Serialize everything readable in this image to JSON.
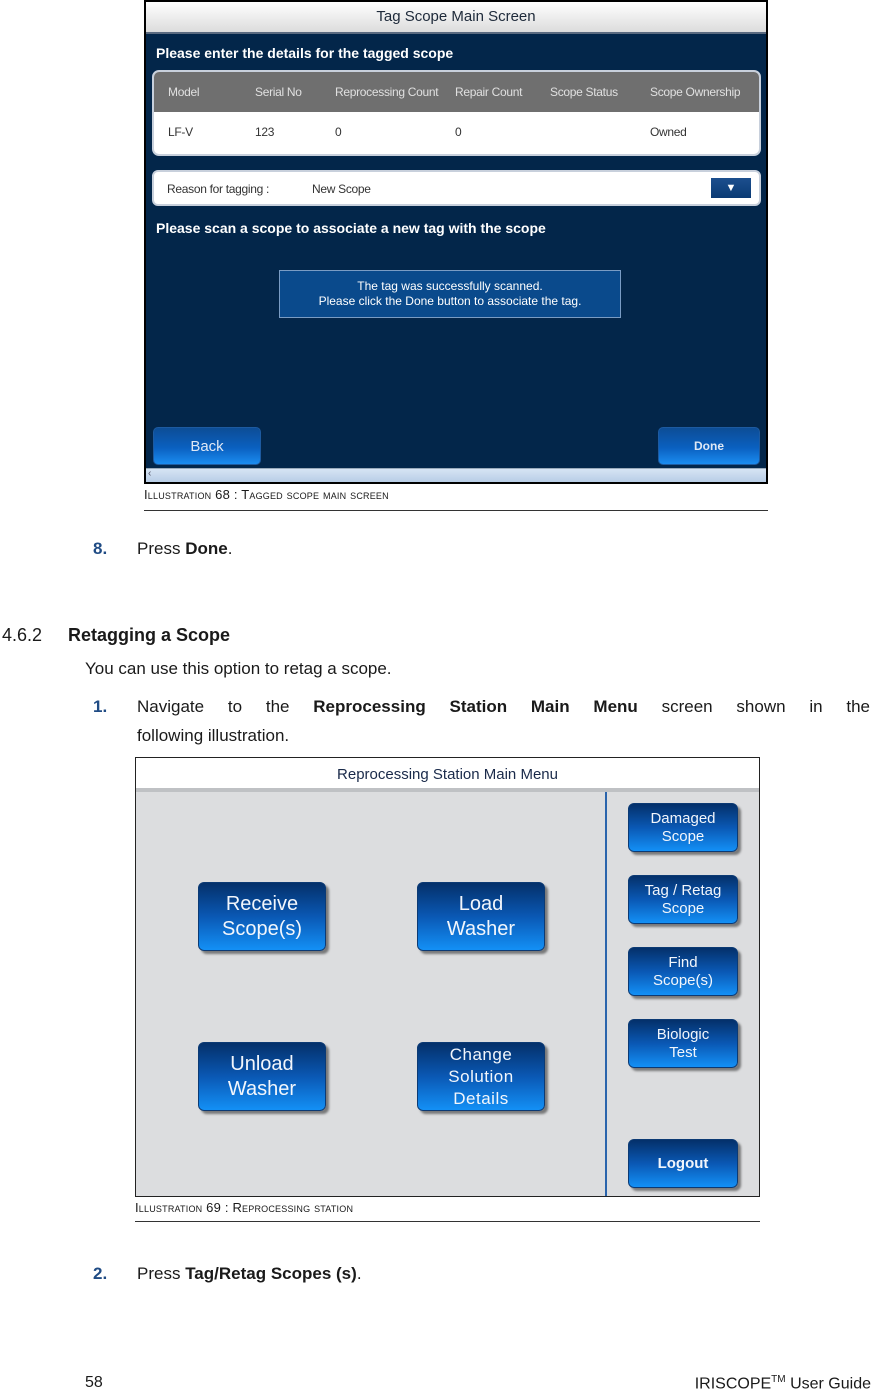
{
  "screen1": {
    "title": "Tag Scope Main Screen",
    "prompt": "Please enter the details for the tagged scope",
    "table": {
      "columns": [
        "Model",
        "Serial No",
        "Reprocessing Count",
        "Repair Count",
        "Scope Status",
        "Scope Ownership"
      ],
      "rows": [
        [
          "LF-V",
          "123",
          "0",
          "0",
          "",
          "Owned"
        ]
      ]
    },
    "reason": {
      "label": "Reason for tagging :",
      "value": "New Scope",
      "icon": "dropdown-arrow-icon"
    },
    "scan_prompt": "Please scan a scope to associate a new tag with the scope",
    "message_line1": "The tag was successfully scanned.",
    "message_line2": "Please click the Done button to associate the tag.",
    "back_label": "Back",
    "done_label": "Done",
    "scroll_icon": "‹"
  },
  "caption1": "Illustration 68 : Tagged scope main screen",
  "step8": {
    "num": "8.",
    "pre": "Press ",
    "bold": "Done",
    "post": "."
  },
  "section": {
    "num": "4.6.2",
    "title": "Retagging a Scope"
  },
  "intro": "You can use this option to retag a scope.",
  "step1": {
    "num": "1.",
    "pre": "Navigate to the ",
    "bold": "Reprocessing Station Main Menu",
    "post": " screen shown in the",
    "line2": "following illustration."
  },
  "screen2": {
    "title": "Reprocessing Station Main Menu",
    "buttons": {
      "receive_l1": "Receive",
      "receive_l2": "Scope(s)",
      "load_l1": "Load",
      "load_l2": "Washer",
      "unload_l1": "Unload",
      "unload_l2": "Washer",
      "change_l1": "Change",
      "change_l2": "Solution Details",
      "damaged_l1": "Damaged",
      "damaged_l2": "Scope",
      "tag_l1": "Tag / Retag",
      "tag_l2": "Scope",
      "find_l1": "Find",
      "find_l2": "Scope(s)",
      "bio_l1": "Biologic",
      "bio_l2": "Test",
      "logout": "Logout"
    }
  },
  "caption2": "Illustration 69 : Reprocessing station",
  "step2": {
    "num": "2.",
    "pre": "Press ",
    "bold": "Tag/Retag Scopes (s)",
    "post": "."
  },
  "footer": {
    "page": "58",
    "guide": "IRISCOPE",
    "tm": "TM",
    "guide_suffix": " User Guide"
  }
}
